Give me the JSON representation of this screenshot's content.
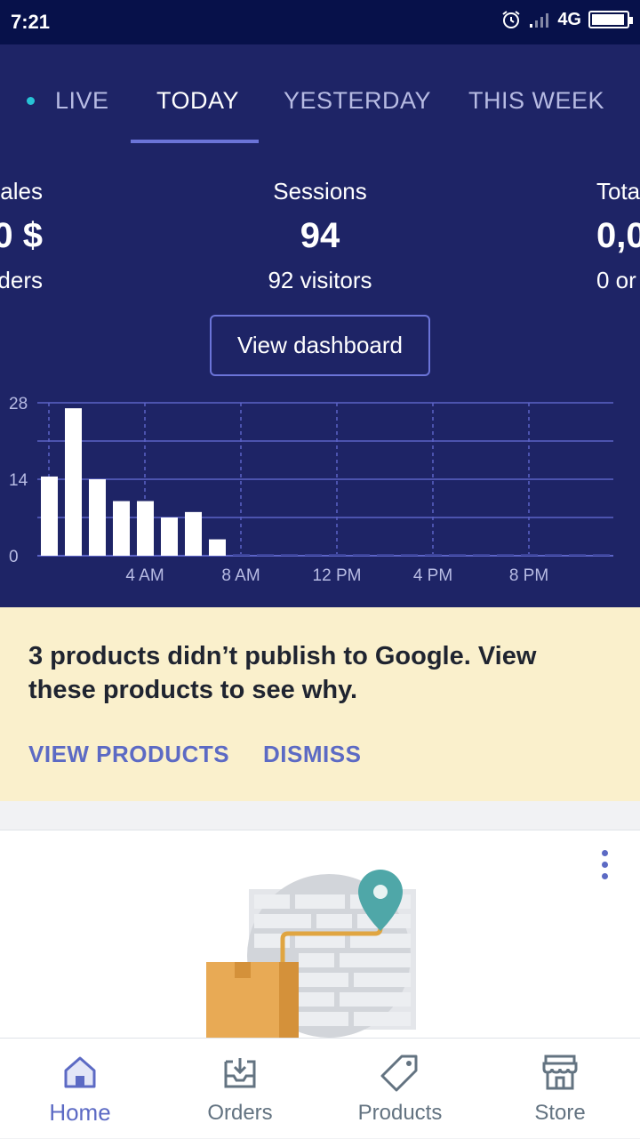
{
  "status_bar": {
    "time": "7:21",
    "network": "4G",
    "battery_level": 0.95
  },
  "tabs": [
    {
      "label": "LIVE",
      "active": false
    },
    {
      "label": "TODAY",
      "active": true
    },
    {
      "label": "YESTERDAY",
      "active": false
    },
    {
      "label": "THIS WEEK",
      "active": false
    }
  ],
  "metrics": {
    "left": {
      "label": "ales",
      "value": "0 $",
      "sub": "ders"
    },
    "center": {
      "label": "Sessions",
      "value": "94",
      "sub": "92 visitors"
    },
    "right": {
      "label": "Tota",
      "value": "0,0",
      "sub": "0 or"
    }
  },
  "dashboard_button": "View dashboard",
  "chart_data": {
    "type": "bar",
    "title": "",
    "xlabel": "",
    "ylabel": "",
    "ylim": [
      0,
      28
    ],
    "y_ticks": [
      "0",
      "14",
      "28"
    ],
    "x_tick_labels": [
      "4 AM",
      "8 AM",
      "12 PM",
      "4 PM",
      "8 PM"
    ],
    "hours": [
      0,
      1,
      2,
      3,
      4,
      5,
      6,
      7,
      8,
      9,
      10,
      11,
      12,
      13,
      14,
      15,
      16,
      17,
      18,
      19,
      20,
      21,
      22,
      23
    ],
    "values": [
      14.5,
      27,
      14,
      10,
      10,
      7,
      8,
      3,
      0,
      0,
      0,
      0,
      0,
      0,
      0,
      0,
      0,
      0,
      0,
      0,
      0,
      0,
      0,
      0
    ],
    "grid": true
  },
  "banner": {
    "message": "3 products didn’t publish to Google. View these products to see why.",
    "view_products": "VIEW PRODUCTS",
    "dismiss": "DISMISS"
  },
  "bottom_nav": [
    {
      "label": "Home",
      "icon": "home-icon",
      "active": true
    },
    {
      "label": "Orders",
      "icon": "orders-icon",
      "active": false
    },
    {
      "label": "Products",
      "icon": "tag-icon",
      "active": false
    },
    {
      "label": "Store",
      "icon": "store-icon",
      "active": false
    }
  ],
  "colors": {
    "header_bg": "#1e2466",
    "accent": "#5c6ac4",
    "banner_bg": "#faf0cc",
    "live_dot": "#27c4d6"
  }
}
